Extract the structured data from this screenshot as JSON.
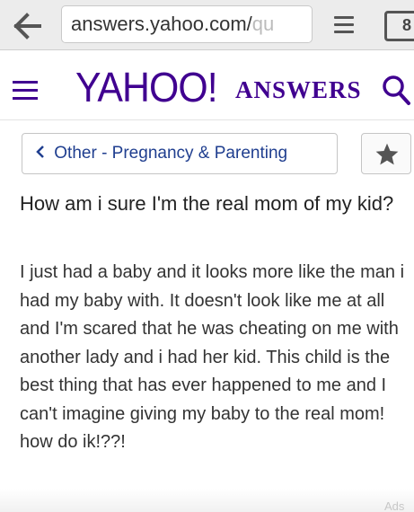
{
  "browser": {
    "url_main": "answers.yahoo.com/",
    "url_faded": "qu",
    "tab_count": "8"
  },
  "header": {
    "logo_yahoo": "YAHOO!",
    "logo_answers": "ANSWERS",
    "brand_color": "#400090"
  },
  "breadcrumb": {
    "label": "Other - Pregnancy & Parenting"
  },
  "question": {
    "title": "How am i sure I'm the real mom of my kid?",
    "body": "I just had a baby and it looks more like the man i had my baby with.  It doesn't look like me at all and I'm scared that he was cheating on me with another lady and i had her kid.  This child is the best thing that has ever happened to me and I can't imagine giving my baby to the real mom! how do ik!??!"
  },
  "ad": {
    "label": "Ads"
  },
  "icons": [
    "back-arrow-icon",
    "menu-icon",
    "tabs-icon",
    "hamburger-icon",
    "search-icon",
    "chevron-left-icon",
    "star-icon"
  ]
}
